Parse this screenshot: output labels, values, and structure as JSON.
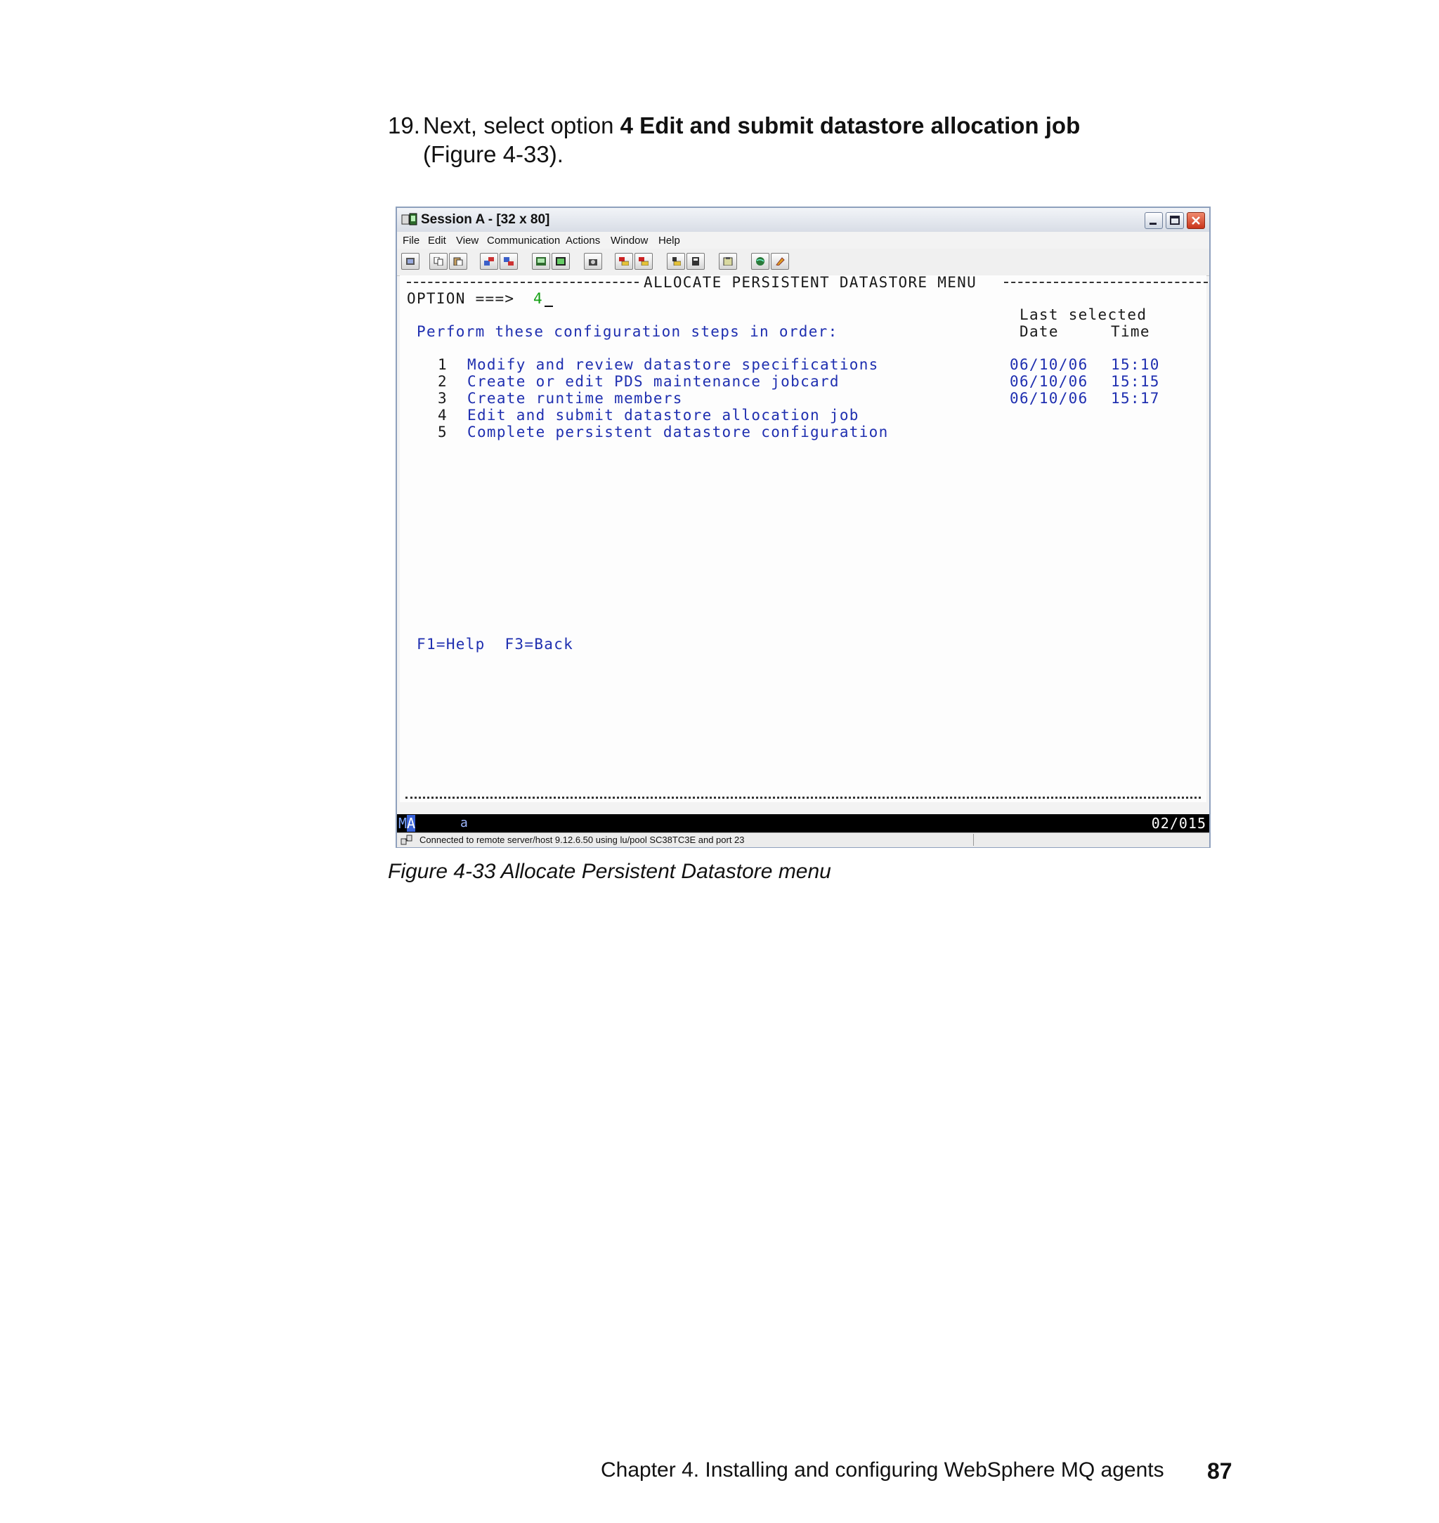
{
  "step": {
    "number": "19.",
    "lead": "Next, select option ",
    "bold": "4 Edit and submit datastore allocation job",
    "ref": "(Figure 4-33)."
  },
  "window": {
    "title": "Session A - [32 x 80]",
    "menu": [
      "File",
      "Edit",
      "View",
      "Communication",
      "Actions",
      "Window",
      "Help"
    ],
    "toolbar_icons": [
      "print-screen-icon",
      "copy-icon",
      "paste-icon",
      "send-icon",
      "receive-icon",
      "display-icon",
      "keyboard-icon",
      "record-icon",
      "play-macro-icon",
      "stop-macro-icon",
      "run-macro-icon",
      "macro-list-icon",
      "clipboard-icon",
      "globe-icon",
      "edit-icon"
    ]
  },
  "terminal": {
    "menu_title": "ALLOCATE PERSISTENT DATASTORE MENU",
    "option_prompt": "OPTION ===>",
    "option_value": "4",
    "last_selected": "Last selected",
    "col_date": "Date",
    "col_time": "Time",
    "instruction": "Perform these configuration steps in order:",
    "steps": [
      {
        "num": "1",
        "label": "Modify and review datastore specifications",
        "date": "06/10/06",
        "time": "15:10"
      },
      {
        "num": "2",
        "label": "Create or edit PDS maintenance jobcard",
        "date": "06/10/06",
        "time": "15:15"
      },
      {
        "num": "3",
        "label": "Create runtime members",
        "date": "06/10/06",
        "time": "15:17"
      },
      {
        "num": "4",
        "label": "Edit and submit datastore allocation job",
        "date": "",
        "time": ""
      },
      {
        "num": "5",
        "label": "Complete persistent datastore configuration",
        "date": "",
        "time": ""
      }
    ],
    "function_keys": "F1=Help  F3=Back"
  },
  "oia": {
    "ma_prefix": "M",
    "ma_selected": "A",
    "indicator": "a",
    "cursor_position": "02/015"
  },
  "status_text": "Connected to remote server/host 9.12.6.50 using lu/pool SC38TC3E and port 23",
  "caption": "Figure 4-33   Allocate Persistent Datastore menu",
  "footer": {
    "chapter": "Chapter 4. Installing and configuring WebSphere MQ agents",
    "page": "87"
  },
  "colors": {
    "terminal_blue": "#1f2fb0",
    "terminal_green": "#14a014",
    "window_border": "#8ea0bd"
  }
}
